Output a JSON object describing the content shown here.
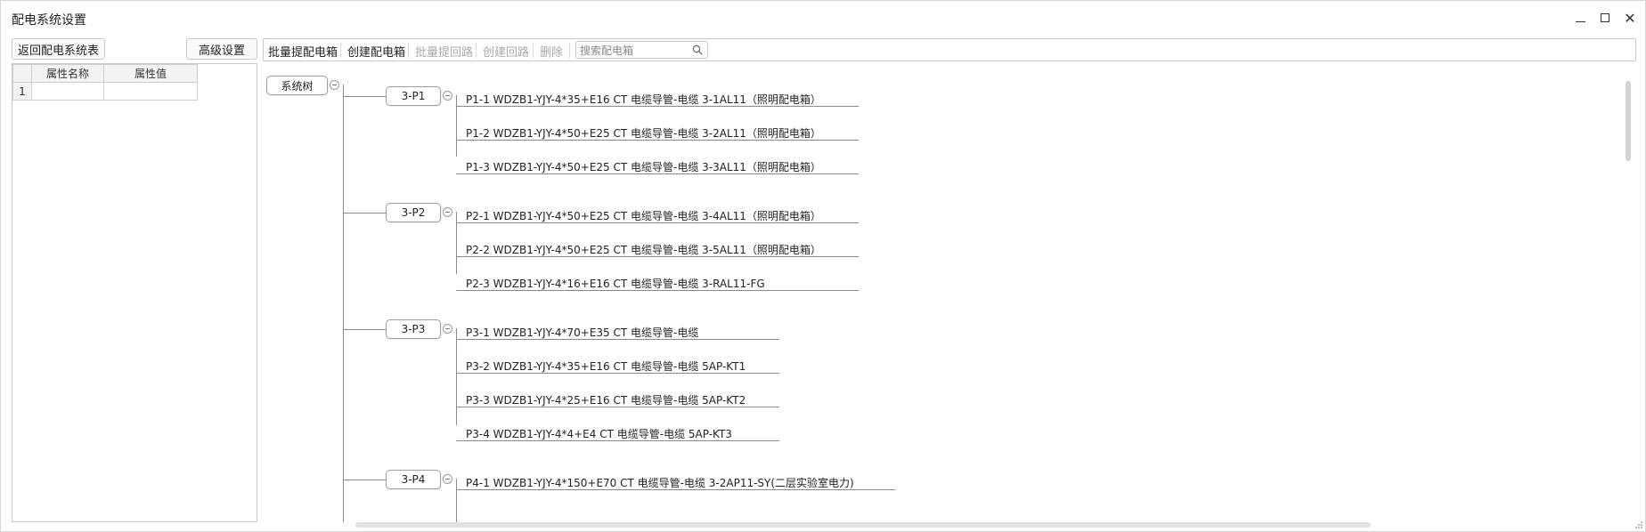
{
  "window": {
    "title": "配电系统设置"
  },
  "left": {
    "back_button": "返回配电系统表",
    "advanced_button": "高级设置",
    "grid": {
      "headers": [
        "属性名称",
        "属性值"
      ],
      "rows": [
        {
          "num": "1",
          "name": "",
          "value": ""
        }
      ]
    }
  },
  "toolbar": {
    "batch_extract_box": "批量提配电箱",
    "create_box": "创建配电箱",
    "batch_extract_loop": "批量提回路",
    "create_loop": "创建回路",
    "delete": "删除",
    "search_placeholder": "搜索配电箱"
  },
  "tree": {
    "root": "系统树",
    "groups": [
      {
        "label": "3-P1",
        "children": [
          "P1-1 WDZB1-YJY-4*35+E16 CT 电缆导管-电缆 3-1AL11（照明配电箱）",
          "P1-2 WDZB1-YJY-4*50+E25 CT 电缆导管-电缆 3-2AL11（照明配电箱）",
          "P1-3 WDZB1-YJY-4*50+E25 CT 电缆导管-电缆 3-3AL11（照明配电箱）"
        ]
      },
      {
        "label": "3-P2",
        "children": [
          "P2-1 WDZB1-YJY-4*50+E25 CT 电缆导管-电缆 3-4AL11（照明配电箱）",
          "P2-2 WDZB1-YJY-4*50+E25 CT 电缆导管-电缆 3-5AL11（照明配电箱）",
          "P2-3 WDZB1-YJY-4*16+E16 CT 电缆导管-电缆 3-RAL11-FG"
        ]
      },
      {
        "label": "3-P3",
        "children": [
          "P3-1 WDZB1-YJY-4*70+E35 CT 电缆导管-电缆",
          "P3-2 WDZB1-YJY-4*35+E16 CT 电缆导管-电缆 5AP-KT1",
          "P3-3 WDZB1-YJY-4*25+E16 CT 电缆导管-电缆 5AP-KT2",
          "P3-4 WDZB1-YJY-4*4+E4 CT 电缆导管-电缆 5AP-KT3"
        ]
      },
      {
        "label": "3-P4",
        "children": [
          "P4-1 WDZB1-YJY-4*150+E70 CT 电缆导管-电缆 3-2AP11-SY(二层实验室电力)"
        ]
      }
    ]
  }
}
